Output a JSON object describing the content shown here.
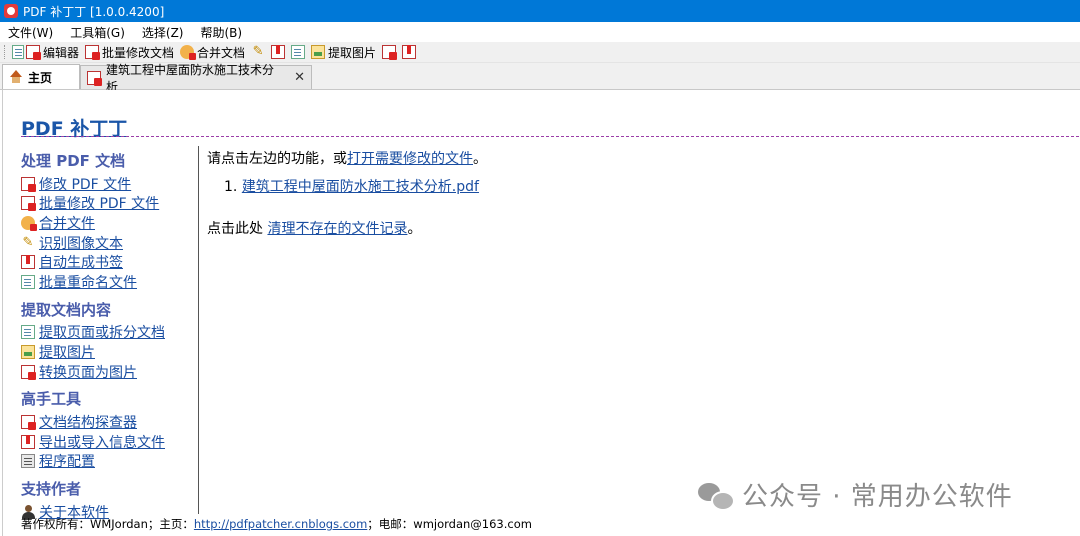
{
  "window": {
    "title": "PDF 补丁丁 [1.0.0.4200]"
  },
  "menu": [
    "文件(W)",
    "工具箱(G)",
    "选择(Z)",
    "帮助(B)"
  ],
  "toolbar": [
    {
      "label": "编辑器",
      "icon": "pdf-editor-icon"
    },
    {
      "label": "批量修改文档",
      "icon": "batch-edit-icon"
    },
    {
      "label": "合并文档",
      "icon": "merge-icon"
    },
    {
      "label": "",
      "icon": "ocr-icon"
    },
    {
      "label": "",
      "icon": "bookmark-icon"
    },
    {
      "label": "",
      "icon": "rename-icon"
    },
    {
      "label": "",
      "icon": "extract-image-icon"
    },
    {
      "label": "提取图片",
      "icon": ""
    },
    {
      "label": "",
      "icon": "convert-icon"
    },
    {
      "label": "",
      "icon": "export-icon"
    }
  ],
  "tabs": [
    {
      "label": "主页",
      "active": true
    },
    {
      "label": "建筑工程中屋面防水施工技术分析",
      "active": false,
      "close": "✕"
    }
  ],
  "app_heading": "PDF 补丁丁",
  "sidebar": {
    "sections": [
      {
        "title": "处理 PDF 文档",
        "items": [
          "修改 PDF 文件",
          "批量修改 PDF 文件",
          "合并文件",
          "识别图像文本",
          "自动生成书签",
          "批量重命名文件"
        ]
      },
      {
        "title": "提取文档内容",
        "items": [
          "提取页面或拆分文档",
          "提取图片",
          "转换页面为图片"
        ]
      },
      {
        "title": "高手工具",
        "items": [
          "文档结构探查器",
          "导出或导入信息文件",
          "程序配置"
        ]
      },
      {
        "title": "支持作者",
        "items": [
          "关于本软件"
        ]
      }
    ]
  },
  "content": {
    "prompt_prefix": "请点击左边的功能，或",
    "prompt_link": "打开需要修改的文件",
    "prompt_suffix": "。",
    "recent_number": "1.",
    "recent_file": "建筑工程中屋面防水施工技术分析.pdf",
    "clean_prefix": "点击此处 ",
    "clean_link": "清理不存在的文件记录",
    "clean_suffix": "。"
  },
  "watermark": "公众号 · 常用办公软件",
  "footer": {
    "prefix": "著作权所有：WMJordan；主页：",
    "homepage": "http://pdfpatcher.cnblogs.com",
    "suffix": "；电邮：wmjordan@163.com"
  }
}
